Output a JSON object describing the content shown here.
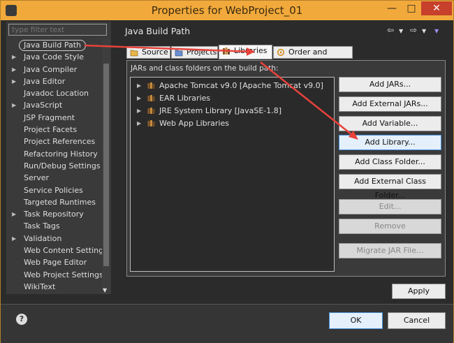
{
  "window": {
    "title": "Properties for WebProject_01"
  },
  "filter": {
    "placeholder": "type filter text"
  },
  "tree": [
    {
      "label": "Java Build Path",
      "expandable": false
    },
    {
      "label": "Java Code Style",
      "expandable": true
    },
    {
      "label": "Java Compiler",
      "expandable": true
    },
    {
      "label": "Java Editor",
      "expandable": true
    },
    {
      "label": "Javadoc Location",
      "expandable": false
    },
    {
      "label": "JavaScript",
      "expandable": true
    },
    {
      "label": "JSP Fragment",
      "expandable": false
    },
    {
      "label": "Project Facets",
      "expandable": false
    },
    {
      "label": "Project References",
      "expandable": false
    },
    {
      "label": "Refactoring History",
      "expandable": false
    },
    {
      "label": "Run/Debug Settings",
      "expandable": false
    },
    {
      "label": "Server",
      "expandable": false
    },
    {
      "label": "Service Policies",
      "expandable": false
    },
    {
      "label": "Targeted Runtimes",
      "expandable": false
    },
    {
      "label": "Task Repository",
      "expandable": true
    },
    {
      "label": "Task Tags",
      "expandable": false
    },
    {
      "label": "Validation",
      "expandable": true
    },
    {
      "label": "Web Content Settings",
      "expandable": false
    },
    {
      "label": "Web Page Editor",
      "expandable": false
    },
    {
      "label": "Web Project Settings",
      "expandable": false
    },
    {
      "label": "WikiText",
      "expandable": false
    }
  ],
  "header": {
    "title": "Java Build Path"
  },
  "tabs": [
    {
      "label": "Source"
    },
    {
      "label": "Projects"
    },
    {
      "label": "Libraries"
    },
    {
      "label": "Order and Export"
    }
  ],
  "libraries": {
    "caption": "JARs and class folders on the build path:",
    "items": [
      {
        "label": "Apache Tomcat v9.0 [Apache Tomcat v9.0]"
      },
      {
        "label": "EAR Libraries"
      },
      {
        "label": "JRE System Library [JavaSE-1.8]"
      },
      {
        "label": "Web App Libraries"
      }
    ]
  },
  "buttons": {
    "add_jars": "Add JARs...",
    "add_external_jars": "Add External JARs...",
    "add_variable": "Add Variable...",
    "add_library": "Add Library...",
    "add_class_folder": "Add Class Folder...",
    "add_external_class_folder": "Add External Class Folder...",
    "edit": "Edit...",
    "remove": "Remove",
    "migrate_jar": "Migrate JAR File...",
    "apply": "Apply",
    "ok": "OK",
    "cancel": "Cancel"
  },
  "colors": {
    "titlebar": "#f2a93b",
    "annotation_arrow": "#e8423a",
    "close_button": "#c7402c"
  }
}
